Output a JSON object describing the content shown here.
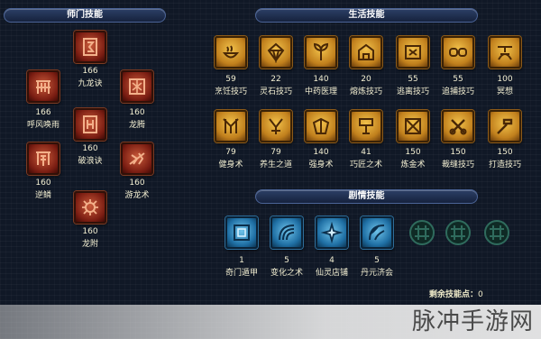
{
  "sections": {
    "school": "师门技能",
    "life": "生活技能",
    "story": "剧情技能"
  },
  "school_skills": [
    {
      "name": "九龙诀",
      "level": "166",
      "icon": "dragon-rune-icon"
    },
    {
      "name": "呼风唤雨",
      "level": "166",
      "icon": "wind-rain-rune-icon"
    },
    {
      "name": "龙腾",
      "level": "160",
      "icon": "dragon-soar-rune-icon"
    },
    {
      "name": "破浪诀",
      "level": "160",
      "icon": "wave-rune-icon"
    },
    {
      "name": "逆鳞",
      "level": "160",
      "icon": "reverse-scale-rune-icon"
    },
    {
      "name": "游龙术",
      "level": "160",
      "icon": "roaming-dragon-rune-icon"
    },
    {
      "name": "龙附",
      "level": "160",
      "icon": "dragon-attach-rune-icon"
    }
  ],
  "life_skills": [
    {
      "name": "烹饪技巧",
      "level": "59",
      "icon": "cooking-icon"
    },
    {
      "name": "灵石技巧",
      "level": "22",
      "icon": "spirit-stone-icon"
    },
    {
      "name": "中药医理",
      "level": "140",
      "icon": "herb-medicine-icon"
    },
    {
      "name": "熔炼技巧",
      "level": "20",
      "icon": "smelting-icon"
    },
    {
      "name": "逃离技巧",
      "level": "55",
      "icon": "escape-icon"
    },
    {
      "name": "追捕技巧",
      "level": "55",
      "icon": "pursuit-icon"
    },
    {
      "name": "冥想",
      "level": "100",
      "icon": "meditation-icon"
    },
    {
      "name": "健身术",
      "level": "79",
      "icon": "fitness-icon"
    },
    {
      "name": "养生之道",
      "level": "79",
      "icon": "health-preserving-icon"
    },
    {
      "name": "强身术",
      "level": "140",
      "icon": "body-strengthening-icon"
    },
    {
      "name": "巧匠之术",
      "level": "41",
      "icon": "craftsman-icon"
    },
    {
      "name": "炼金术",
      "level": "150",
      "icon": "alchemy-icon"
    },
    {
      "name": "裁缝技巧",
      "level": "150",
      "icon": "tailoring-icon"
    },
    {
      "name": "打造技巧",
      "level": "150",
      "icon": "forging-icon"
    }
  ],
  "story_skills": [
    {
      "name": "奇门遁甲",
      "level": "1",
      "icon": "qimen-dunjia-icon"
    },
    {
      "name": "变化之术",
      "level": "5",
      "icon": "transformation-icon"
    },
    {
      "name": "仙灵店铺",
      "level": "4",
      "icon": "fairy-shop-icon"
    },
    {
      "name": "丹元济会",
      "level": "5",
      "icon": "elixir-icon"
    }
  ],
  "empty_slot_icon": "locked-slot-icon",
  "remaining": {
    "label": "剩余技能点：",
    "value": "0"
  },
  "watermark": "脉冲手游网",
  "colors": {
    "school_tile": "#8a2416",
    "life_tile": "#d19a2f",
    "story_tile": "#2b84bd",
    "empty_slot": "#1d4a3f",
    "header_bar": "#22355a",
    "text": "#f0eccb"
  }
}
